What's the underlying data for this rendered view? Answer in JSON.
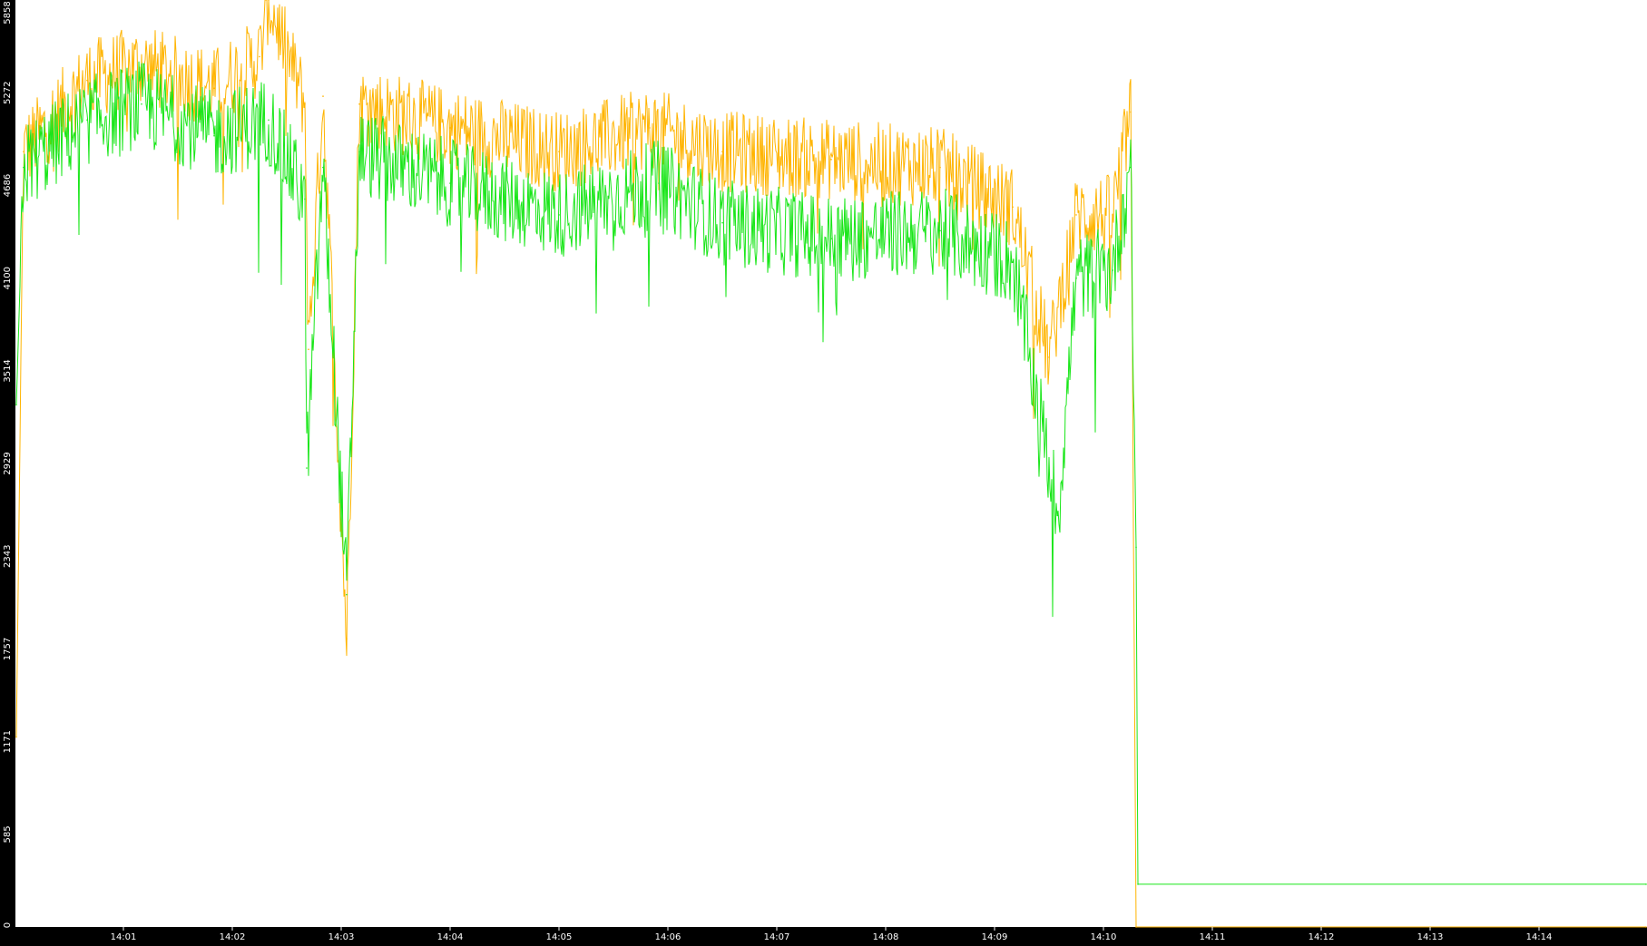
{
  "colors": {
    "background": "#000000",
    "plot_background": "#ffffff",
    "axis_text": "#ffffff",
    "series_orange": "#ffb400",
    "series_green": "#19e619"
  },
  "chart_data": {
    "type": "line",
    "title": "",
    "xlabel": "",
    "ylabel": "",
    "grid": false,
    "legend": "none",
    "ylim": [
      0,
      5858
    ],
    "y_ticks": [
      "0",
      "585",
      "1171",
      "1757",
      "2343",
      "2929",
      "3514",
      "4100",
      "4686",
      "5272",
      "5858"
    ],
    "x_ticks": [
      "14:01",
      "14:02",
      "14:03",
      "14:04",
      "14:05",
      "14:06",
      "14:07",
      "14:08",
      "14:09",
      "14:10",
      "14:11",
      "14:12",
      "14:13",
      "14:14"
    ],
    "x_range_minutes": [
      "14:00:01",
      "14:14:59"
    ],
    "series": [
      {
        "color": "#ffb400",
        "description_points": [
          {
            "t": "14:00:01",
            "value": 1200
          },
          {
            "t": "14:00:05",
            "value": 4900
          },
          {
            "t": "14:00:40",
            "value": 5350
          },
          {
            "t": "14:01:10",
            "value": 5450
          },
          {
            "t": "14:01:50",
            "value": 5300
          },
          {
            "t": "14:02:15",
            "value": 5500
          },
          {
            "t": "14:02:20",
            "value": 5858
          },
          {
            "t": "14:02:40",
            "value": 5200
          },
          {
            "t": "14:02:42",
            "value": 3650
          },
          {
            "t": "14:02:50",
            "value": 5250
          },
          {
            "t": "14:03:03",
            "value": 1820
          },
          {
            "t": "14:03:10",
            "value": 5200
          },
          {
            "t": "14:04:00",
            "value": 5050
          },
          {
            "t": "14:05:00",
            "value": 4900
          },
          {
            "t": "14:05:50",
            "value": 5050
          },
          {
            "t": "14:06:30",
            "value": 4900
          },
          {
            "t": "14:07:30",
            "value": 4850
          },
          {
            "t": "14:08:30",
            "value": 4800
          },
          {
            "t": "14:09:10",
            "value": 4550
          },
          {
            "t": "14:09:30",
            "value": 3600
          },
          {
            "t": "14:09:45",
            "value": 4500
          },
          {
            "t": "14:10:05",
            "value": 4500
          },
          {
            "t": "14:10:15",
            "value": 5150
          },
          {
            "t": "14:10:18",
            "value": 0
          },
          {
            "t": "14:14:59",
            "value": 0
          }
        ]
      },
      {
        "color": "#19e619",
        "description_points": [
          {
            "t": "14:00:01",
            "value": 3300
          },
          {
            "t": "14:00:05",
            "value": 4800
          },
          {
            "t": "14:00:40",
            "value": 5100
          },
          {
            "t": "14:01:10",
            "value": 5200
          },
          {
            "t": "14:01:50",
            "value": 5000
          },
          {
            "t": "14:02:20",
            "value": 5100
          },
          {
            "t": "14:02:40",
            "value": 4600
          },
          {
            "t": "14:02:41",
            "value": 2900
          },
          {
            "t": "14:02:50",
            "value": 4800
          },
          {
            "t": "14:03:03",
            "value": 2100
          },
          {
            "t": "14:03:10",
            "value": 4900
          },
          {
            "t": "14:04:00",
            "value": 4700
          },
          {
            "t": "14:05:00",
            "value": 4500
          },
          {
            "t": "14:05:55",
            "value": 4700
          },
          {
            "t": "14:06:30",
            "value": 4450
          },
          {
            "t": "14:07:30",
            "value": 4350
          },
          {
            "t": "14:08:30",
            "value": 4400
          },
          {
            "t": "14:09:10",
            "value": 4200
          },
          {
            "t": "14:09:35",
            "value": 2600
          },
          {
            "t": "14:09:45",
            "value": 4100
          },
          {
            "t": "14:10:05",
            "value": 4150
          },
          {
            "t": "14:10:15",
            "value": 4800
          },
          {
            "t": "14:10:18",
            "value": 2400
          },
          {
            "t": "14:10:19",
            "value": 270
          },
          {
            "t": "14:14:59",
            "value": 270
          }
        ]
      }
    ]
  }
}
